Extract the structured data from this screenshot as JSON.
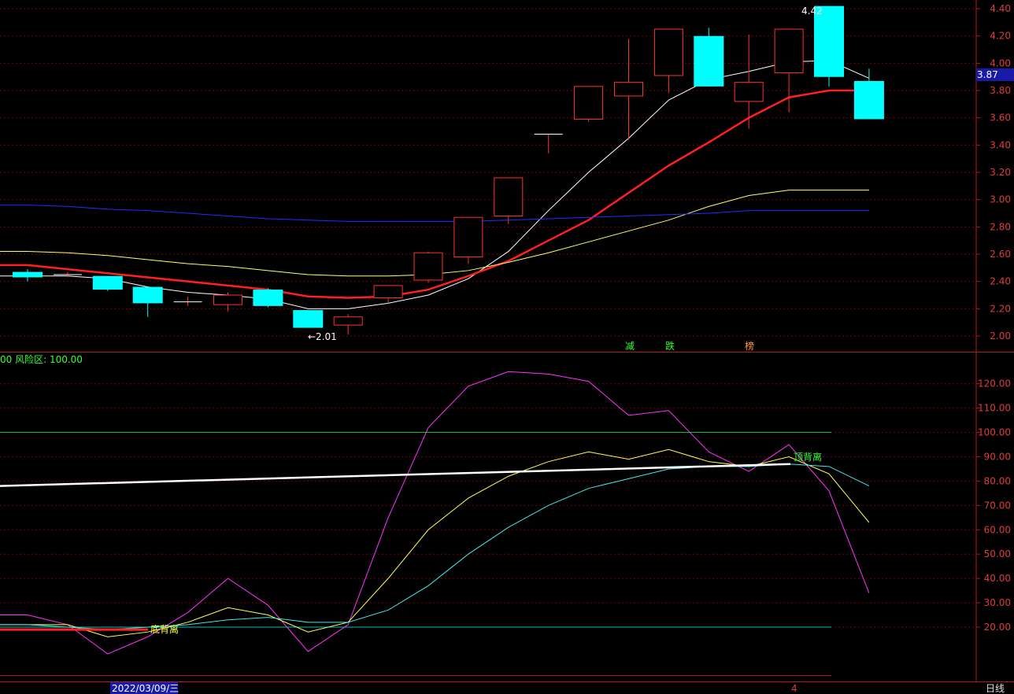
{
  "chart_data": [
    {
      "type": "candlestick",
      "price_ylim": [
        1.92,
        4.47
      ],
      "price_ticks": [
        "4.40",
        "4.20",
        "4.00",
        "3.80",
        "3.60",
        "3.40",
        "3.20",
        "3.00",
        "2.80",
        "2.60",
        "2.40",
        "2.20",
        "2.00"
      ],
      "candles": [
        {
          "o": 2.47,
          "c": 2.43,
          "h": 2.49,
          "l": 2.4
        },
        {
          "o": 2.45,
          "c": 2.45,
          "h": 2.47,
          "l": 2.43
        },
        {
          "o": 2.44,
          "c": 2.34,
          "h": 2.44,
          "l": 2.33
        },
        {
          "o": 2.36,
          "c": 2.24,
          "h": 2.36,
          "l": 2.14
        },
        {
          "o": 2.25,
          "c": 2.25,
          "h": 2.29,
          "l": 2.22
        },
        {
          "o": 2.23,
          "c": 2.3,
          "h": 2.32,
          "l": 2.18
        },
        {
          "o": 2.34,
          "c": 2.22,
          "h": 2.35,
          "l": 2.21
        },
        {
          "o": 2.19,
          "c": 2.06,
          "h": 2.19,
          "l": 2.06
        },
        {
          "o": 2.08,
          "c": 2.14,
          "h": 2.16,
          "l": 2.01
        },
        {
          "o": 2.28,
          "c": 2.37,
          "h": 2.37,
          "l": 2.24
        },
        {
          "o": 2.41,
          "c": 2.61,
          "h": 2.62,
          "l": 2.39
        },
        {
          "o": 2.58,
          "c": 2.87,
          "h": 2.87,
          "l": 2.53
        },
        {
          "o": 2.88,
          "c": 3.16,
          "h": 3.16,
          "l": 2.82
        },
        {
          "o": 3.48,
          "c": 3.48,
          "h": 3.48,
          "l": 3.34
        },
        {
          "o": 3.59,
          "c": 3.83,
          "h": 3.83,
          "l": 3.57
        },
        {
          "o": 3.76,
          "c": 3.86,
          "h": 4.18,
          "l": 3.44
        },
        {
          "o": 3.91,
          "c": 4.25,
          "h": 4.25,
          "l": 3.78
        },
        {
          "o": 4.2,
          "c": 3.83,
          "h": 4.26,
          "l": 3.83
        },
        {
          "o": 3.72,
          "c": 3.86,
          "h": 4.21,
          "l": 3.52
        },
        {
          "o": 3.93,
          "c": 4.25,
          "h": 4.25,
          "l": 3.64
        },
        {
          "o": 4.42,
          "c": 3.9,
          "h": 4.42,
          "l": 3.83
        },
        {
          "o": 3.87,
          "c": 3.59,
          "h": 3.96,
          "l": 3.59
        }
      ],
      "series": [
        {
          "color": "#ffffff",
          "values": [
            2.44,
            2.44,
            2.42,
            2.36,
            2.32,
            2.3,
            2.27,
            2.2,
            2.2,
            2.24,
            2.3,
            2.42,
            2.62,
            2.92,
            3.2,
            3.45,
            3.73,
            3.88,
            3.94,
            4.01,
            4.02,
            3.89
          ]
        },
        {
          "color": "#ff2020",
          "values": [
            2.52,
            2.49,
            2.46,
            2.43,
            2.4,
            2.37,
            2.34,
            2.29,
            2.28,
            2.29,
            2.34,
            2.44,
            2.55,
            2.7,
            2.85,
            3.05,
            3.25,
            3.42,
            3.6,
            3.75,
            3.8,
            3.8
          ]
        },
        {
          "color": "#ffff66",
          "values": [
            2.62,
            2.61,
            2.59,
            2.56,
            2.53,
            2.51,
            2.48,
            2.45,
            2.44,
            2.44,
            2.45,
            2.48,
            2.54,
            2.61,
            2.69,
            2.77,
            2.85,
            2.95,
            3.03,
            3.07,
            3.07,
            3.07
          ]
        },
        {
          "color": "#2a2aff",
          "values": [
            2.96,
            2.95,
            2.93,
            2.92,
            2.9,
            2.88,
            2.86,
            2.85,
            2.84,
            2.84,
            2.84,
            2.84,
            2.85,
            2.86,
            2.87,
            2.88,
            2.89,
            2.9,
            2.92,
            2.92,
            2.92,
            2.92
          ]
        }
      ],
      "last_price": "3.87",
      "annotations": {
        "high": "4.42",
        "low": "←2.01",
        "signal_1": "减",
        "signal_2": "跌",
        "signal_3": "榜"
      }
    },
    {
      "type": "line",
      "ylim": [
        10,
        130
      ],
      "ticks": [
        "120.00",
        "110.00",
        "100.00",
        "90.00",
        "80.00",
        "70.00",
        "60.00",
        "50.00",
        "40.00",
        "30.00",
        "20.00"
      ],
      "legend": "00  风险区: 100.00",
      "reference_lines": [
        {
          "value": 100,
          "color": "#1fbf1f"
        },
        {
          "value": 20,
          "color": "#00bfbf"
        }
      ],
      "series": [
        {
          "color": "#ff33ff",
          "values": [
            25,
            21,
            9,
            16,
            26,
            40,
            29,
            10,
            21,
            65,
            102,
            119,
            125,
            124,
            121,
            107,
            109,
            92,
            84,
            95,
            76,
            34
          ]
        },
        {
          "color": "#ffff55",
          "values": [
            21,
            21,
            16,
            18,
            22,
            28,
            25,
            18,
            22,
            40,
            60,
            73,
            82,
            88,
            92,
            89,
            93,
            88,
            86,
            90,
            83,
            63
          ]
        },
        {
          "color": "#44e8e8",
          "values": [
            21,
            20,
            19,
            20,
            21,
            23,
            24,
            22,
            22,
            27,
            37,
            50,
            61,
            70,
            77,
            81,
            85,
            86,
            86,
            87,
            86,
            78
          ]
        }
      ],
      "white_line": [
        78.0,
        87.0
      ],
      "red_line": [
        19.0,
        19.0
      ],
      "labels": {
        "top_divergence": "顶背离",
        "bottom_divergence": "底背离"
      }
    }
  ],
  "footer": {
    "date_label": "2022/03/09/三",
    "cursor_label": "4",
    "period": "日线"
  },
  "colors": {
    "grid": "#7a0000",
    "axis": "#b01c1c",
    "up": "#ff3030",
    "down": "#00ffff"
  }
}
